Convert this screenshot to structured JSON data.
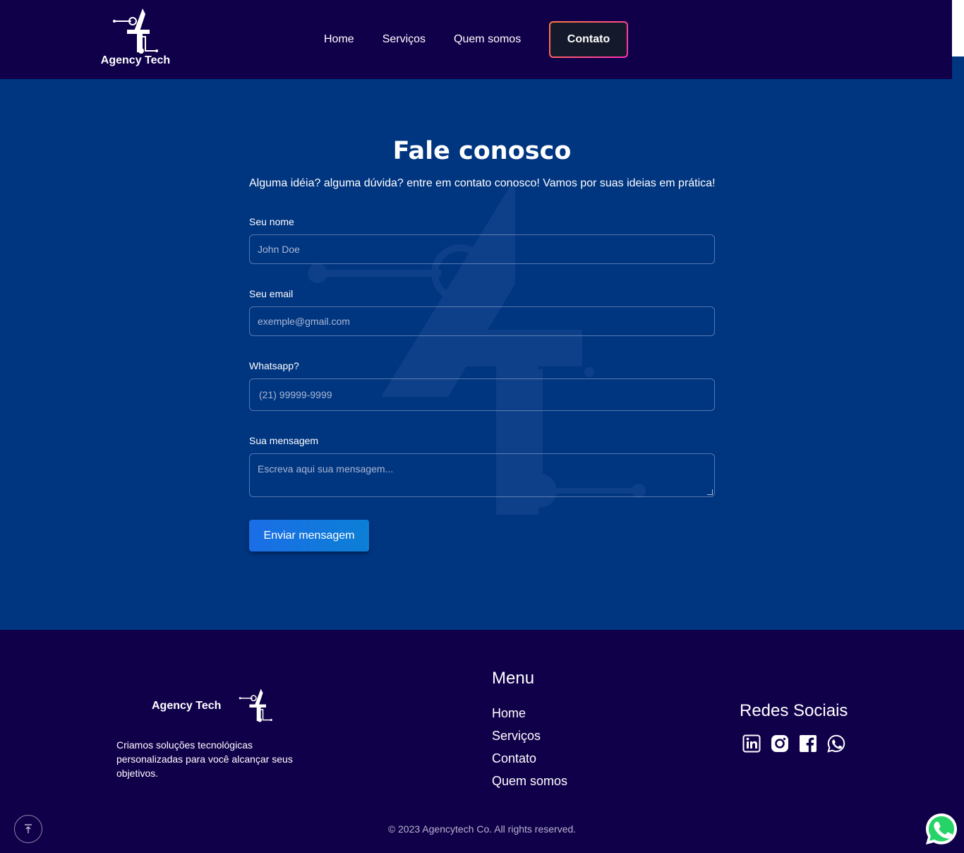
{
  "brand": {
    "name": "Agency Tech"
  },
  "nav": {
    "items": [
      "Home",
      "Serviços",
      "Quem somos"
    ],
    "contact_label": "Contato"
  },
  "contact": {
    "title": "Fale conosco",
    "subtitle": "Alguma idéia? alguma dúvida? entre em contato conosco! Vamos por suas ideias em prática!",
    "name_label": "Seu nome",
    "name_placeholder": "John Doe",
    "email_label": "Seu email",
    "email_placeholder": "exemple@gmail.com",
    "whatsapp_label": "Whatsapp?",
    "whatsapp_placeholder": "(21) 99999-9999",
    "message_label": "Sua mensagem",
    "message_placeholder": "Escreva aqui sua mensagem...",
    "submit_label": "Enviar mensagem"
  },
  "footer": {
    "brand": "Agency Tech",
    "description": "Criamos soluções tecnológicas personalizadas para você alcançar seus objetivos.",
    "menu_title": "Menu",
    "menu_items": [
      "Home",
      "Serviços",
      "Contato",
      "Quem somos"
    ],
    "social_title": "Redes Sociais",
    "social_icons": [
      "linkedin-icon",
      "instagram-icon",
      "facebook-icon",
      "whatsapp-icon"
    ],
    "copyright": "© 2023 Agencytech Co. All rights reserved.",
    "back_to_top_icon": "arrow-up-icon"
  },
  "colors": {
    "header_bg": "#10004a",
    "main_bg": "#003580",
    "button_blue": "#1a6ee6",
    "contact_border_start": "#ff7a3c",
    "contact_border_end": "#ff2fb4"
  }
}
